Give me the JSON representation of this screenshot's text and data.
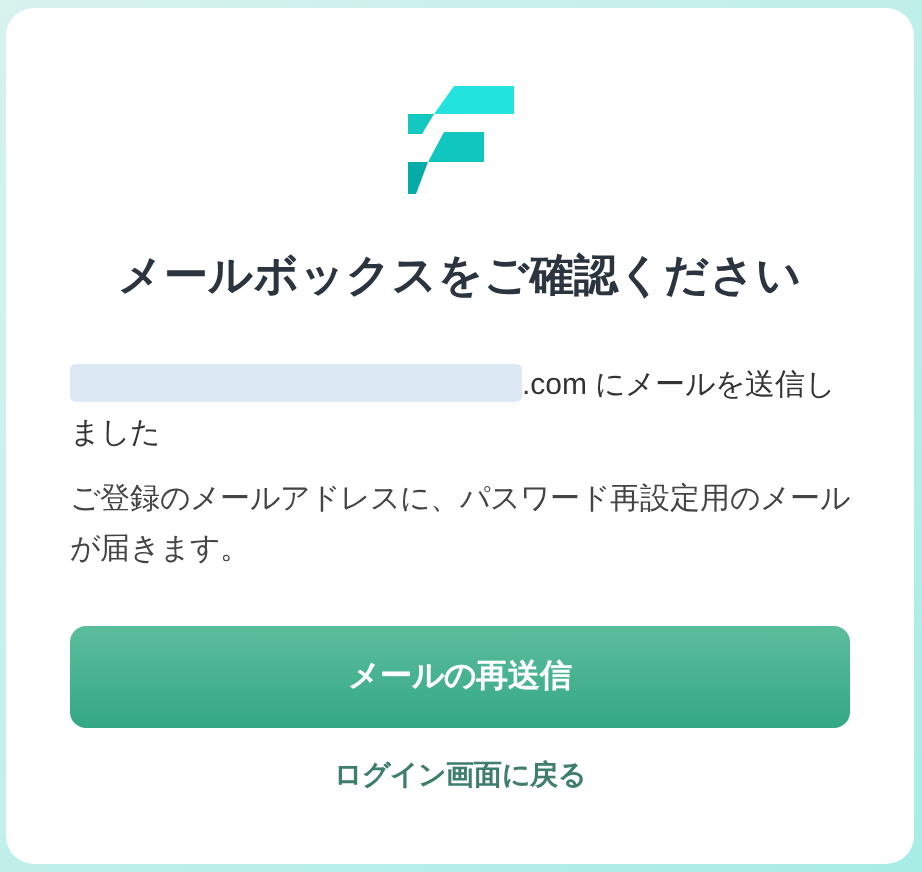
{
  "title": "メールボックスをご確認ください",
  "sent_message": {
    "email_redacted": true,
    "text": ".com にメールを送信しました"
  },
  "info": "ご登録のメールアドレスに、パスワード再設定用のメールが届きます。",
  "resend_button": "メールの再送信",
  "back_link": "ログイン画面に戻る"
}
